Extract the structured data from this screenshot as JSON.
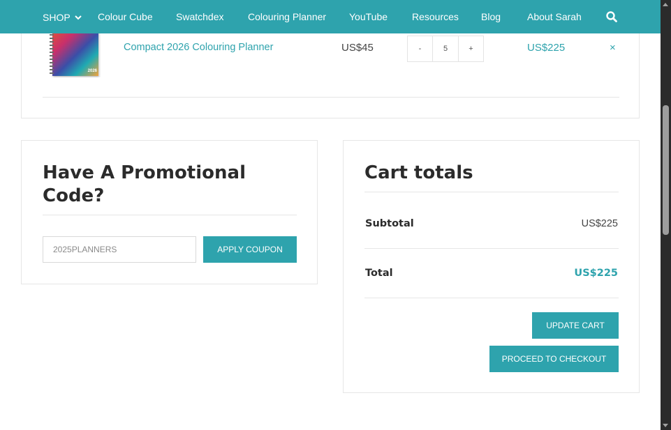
{
  "nav": {
    "items": [
      {
        "label": "SHOP",
        "has_caret": true
      },
      {
        "label": "Colour Cube"
      },
      {
        "label": "Swatchdex"
      },
      {
        "label": "Colouring Planner"
      },
      {
        "label": "YouTube"
      },
      {
        "label": "Resources"
      },
      {
        "label": "Blog"
      },
      {
        "label": "About Sarah"
      }
    ],
    "search_icon": "search-icon",
    "background": "#2ea3ad"
  },
  "cart": {
    "item": {
      "name": "Compact 2026 Colouring Planner",
      "thumbnail_year": "2026",
      "price": "US$45",
      "quantity": "5",
      "decrement": "-",
      "increment": "+",
      "subtotal": "US$225",
      "remove": "×"
    }
  },
  "promo": {
    "title": "Have A Promotional Code?",
    "coupon_value": "2025PLANNERS",
    "apply_label": "APPLY COUPON"
  },
  "totals": {
    "title": "Cart totals",
    "subtotal_label": "Subtotal",
    "subtotal_value": "US$225",
    "total_label": "Total",
    "total_value": "US$225",
    "update_label": "UPDATE CART",
    "checkout_label": "PROCEED TO CHECKOUT"
  },
  "colors": {
    "accent": "#2ea3ad",
    "text": "#2b2b2b",
    "border": "#e6e6e6",
    "scrollbar": "#2b2b2b"
  }
}
